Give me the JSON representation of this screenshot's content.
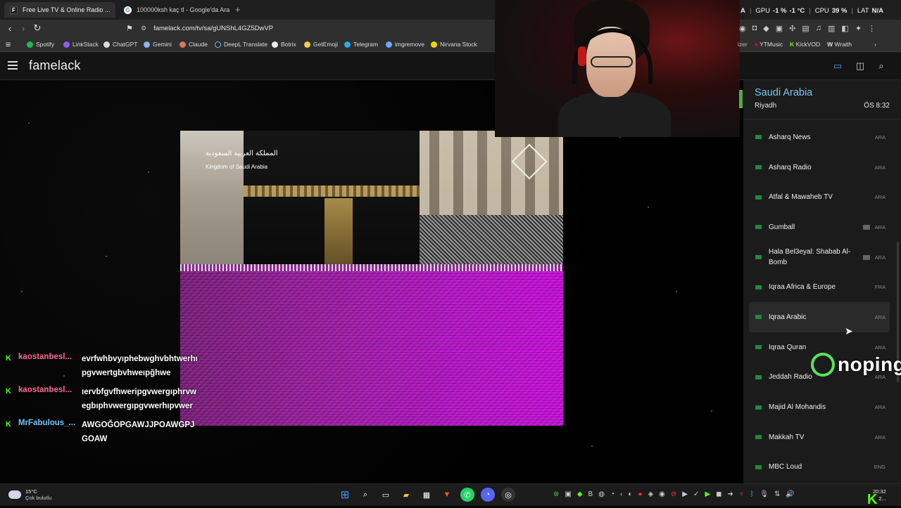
{
  "browser": {
    "tabs": [
      {
        "title": "Free Live TV & Online Radio ...",
        "favicon": "F"
      },
      {
        "title": "100000ksh kaç tl - Google'da Ara",
        "favicon": "G"
      }
    ],
    "url": "famelack.com/tv/sa/gUNShL4GZ5DwVP",
    "bookmarks": [
      "Spotify",
      "LinkStack",
      "ChatGPT",
      "Gemini",
      "Claude",
      "DeepL Translate",
      "Botrix",
      "GetEmoji",
      "Telegram",
      "imgremove",
      "Nirvana Stock"
    ],
    "bookmarks_right": [
      "YTMusic",
      "KickVOD",
      "Wraith"
    ]
  },
  "system_stats": {
    "gpu_label": "GPU",
    "gpu_value": "-1 %",
    "gpu_temp": "-1 °C",
    "cpu_label": "CPU",
    "cpu_value": "39 %",
    "lat_label": "LAT",
    "lat_value": "N/A",
    "prefix": "A"
  },
  "site": {
    "brand": "famelack"
  },
  "player": {
    "logo_ar": "المملكة العربية السعودية",
    "logo_en": "Kingdom of Saudi Arabia"
  },
  "sidebar": {
    "country": "Saudi Arabia",
    "city": "Riyadh",
    "time": "ÖS 8:32",
    "channels": [
      {
        "name": "Asharq News",
        "lang": "ARA",
        "video": false
      },
      {
        "name": "Asharq Radio",
        "lang": "ARA",
        "video": false
      },
      {
        "name": "Atfal & Mawaheb TV",
        "lang": "ARA",
        "video": false
      },
      {
        "name": "Gumball",
        "lang": "ARA",
        "video": true
      },
      {
        "name": "Hala Bel3eyal: Shabab Al-Bomb",
        "lang": "ARA",
        "video": true
      },
      {
        "name": "Iqraa Africa & Europe",
        "lang": "FRA",
        "video": false
      },
      {
        "name": "Iqraa Arabic",
        "lang": "ARA",
        "video": false
      },
      {
        "name": "Iqraa Quran",
        "lang": "ARA",
        "video": false
      },
      {
        "name": "Jeddah Radio",
        "lang": "ARA",
        "video": false
      },
      {
        "name": "Majid Al Mohandis",
        "lang": "ARA",
        "video": false
      },
      {
        "name": "Makkah TV",
        "lang": "ARA",
        "video": false
      },
      {
        "name": "MBC Loud",
        "lang": "ENG",
        "video": false
      }
    ]
  },
  "chat": [
    {
      "user": "kaostanbesl...",
      "text": "evrfwhbvyıphebwghvbhtwerhıpgvwertgbvhweıpğhwe",
      "color": "#ff6a8e"
    },
    {
      "user": "kaostanbesl...",
      "text": "ıervbfgvfhweripgvwergıphrvwegbıphvwergıpgvwerhıpvwer",
      "color": "#ff6a8e"
    },
    {
      "user": "MrFabulous_...",
      "text": "AWGOĞOPGAWJJPOAWGPJGOAW",
      "color": "#6ec3ff"
    }
  ],
  "overlay": {
    "sponsor": "noping"
  },
  "taskbar": {
    "temp": "15°C",
    "weather": "Çok bulutlu",
    "time": "20:32",
    "date": "2..."
  }
}
